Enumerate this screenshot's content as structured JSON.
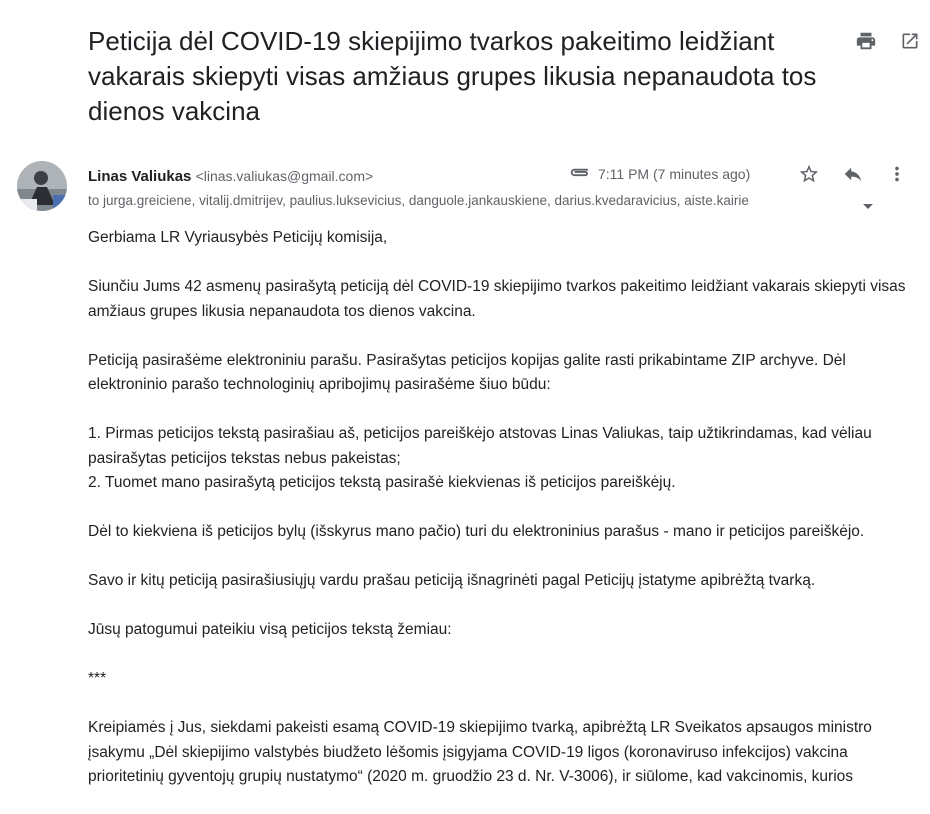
{
  "email": {
    "subject": "Peticija dėl COVID-19 skiepijimo tvarkos pakeitimo leidžiant vakarais skiepyti visas amžiaus grupes likusia nepanaudota tos dienos vakcina",
    "sender_name": "Linas Valiukas",
    "sender_email": "<linas.valiukas@gmail.com>",
    "time": "7:11 PM (7 minutes ago)",
    "recipients": "to jurga.greiciene, vitalij.dmitrijev, paulius.luksevicius, danguole.jankauskiene, darius.kvedaravicius, aiste.kairie",
    "body": {
      "greeting": "Gerbiama LR Vyriausybės Peticijų komisija,",
      "p1": "Siunčiu Jums 42 asmenų pasirašytą peticiją dėl COVID-19 skiepijimo tvarkos pakeitimo leidžiant vakarais skiepyti visas amžiaus grupes likusia nepanaudota tos dienos vakcina.",
      "p2": "Peticiją pasirašėme elektroniniu parašu. Pasirašytas peticijos kopijas galite rasti prikabintame ZIP archyve. Dėl elektroninio parašo technologinių apribojimų pasirašėme šiuo būdu:",
      "list_item_1": "1. Pirmas peticijos tekstą pasirašiau aš, peticijos pareiškėjo atstovas Linas Valiukas, taip užtikrindamas, kad vėliau pasirašytas peticijos tekstas nebus pakeistas;",
      "list_item_2": "2. Tuomet mano pasirašytą peticijos tekstą pasirašė kiekvienas iš peticijos pareiškėjų.",
      "p3": "Dėl to kiekviena iš peticijos bylų (išskyrus mano pačio) turi du elektroninius parašus - mano ir peticijos pareiškėjo.",
      "p4": "Savo ir kitų peticiją pasirašiusiųjų vardu prašau peticiją išnagrinėti pagal Peticijų įstatyme apibrėžtą tvarką.",
      "p5": "Jūsų patogumui pateikiu visą peticijos tekstą žemiau:",
      "separator": "***",
      "p6": "Kreipiamės į Jus, siekdami pakeisti esamą COVID-19 skiepijimo tvarką, apibrėžtą LR Sveikatos apsaugos ministro įsakymu „Dėl skiepijimo valstybės biudžeto lėšomis įsigyjama COVID-19 ligos (koronaviruso infekcijos) vakcina prioritetinių gyventojų grupių nustatymo“ (2020 m.  gruodžio 23 d. Nr. V-3006), ir siūlome, kad vakcinomis, kurios"
    }
  },
  "icons": {
    "print": "print-icon",
    "open_new_window": "open-in-new-window-icon",
    "attachment": "paperclip-icon",
    "star": "star-icon",
    "reply": "reply-icon",
    "more": "more-vertical-icon",
    "recipients_caret": "caret-down-icon"
  },
  "colors": {
    "icon": "#5f6368",
    "text": "#222222",
    "secondary": "#5f6368"
  }
}
